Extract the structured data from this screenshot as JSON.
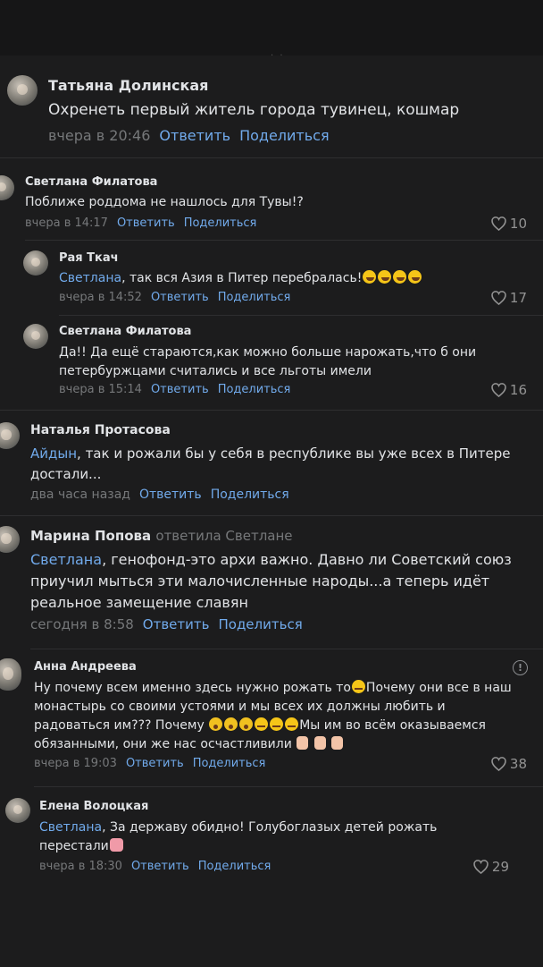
{
  "topbar": {
    "mark": ". ."
  },
  "actions": {
    "reply": "Ответить",
    "share": "Поделиться"
  },
  "comments": [
    {
      "name": "Татьяна Долинская",
      "text": "Охренеть первый житель города тувинец, кошмар",
      "time": "вчера в 20:46"
    },
    {
      "name": "Светлана Филатова",
      "text": "Поближе роддома не нашлось для Тувы!?",
      "time": "вчера в 14:17",
      "likes": "10"
    },
    {
      "name": "Рая Ткач",
      "mention": "Светлана",
      "text": ", так вся Азия в Питер перебралась!",
      "emoji": [
        "rolling-laugh",
        "rolling-laugh",
        "rolling-laugh",
        "rolling-laugh"
      ],
      "time": "вчера в 14:52",
      "likes": "17"
    },
    {
      "name": "Светлана Филатова",
      "text_lines": [
        "Да!! Да ещё стараются,как можно больше нарожать,что б они",
        "петербуржцами считались и все льготы имели"
      ],
      "time": "вчера в 15:14",
      "likes": "16"
    },
    {
      "name": "Наталья Протасова",
      "mention": "Айдын",
      "text_lines": [
        ", так и рожали бы у себя в республике вы уже всех в Питере",
        "достали..."
      ],
      "time": "два часа назад"
    },
    {
      "name": "Марина Попова",
      "reply_to": "ответила Светлане",
      "mention": "Светлана",
      "text_lines": [
        ", генофонд-это архи важно. Давно ли Советский союз",
        "приучил мыться эти малочисленные народы...а теперь идёт",
        "реальное замещение славян"
      ],
      "time": "сегодня в 8:58"
    },
    {
      "name": "Анна Андреева",
      "text_lines": [
        "Ну почему всем именно здесь нужно рожать то",
        "Почему они все в наш",
        "монастырь со своими устоями и мы всех их должны любить и",
        "радоваться им??? Почему ",
        "Мы им во всём оказываемся",
        "обязанными, они же нас осчастливили "
      ],
      "emoji": [
        "sad-face",
        "scream-face",
        "scream-face",
        "scream-face",
        "sad-face",
        "sad-face",
        "sad-face",
        "hand",
        "hand",
        "hand"
      ],
      "time": "вчера в 19:03",
      "likes": "38"
    },
    {
      "name": "Елена Волоцкая",
      "mention": "Светлана",
      "text_lines": [
        ", За державу обидно! Голубоглазых детей рожать",
        "перестали"
      ],
      "emoji": [
        "girl-gesture"
      ],
      "time": "вчера в 18:30",
      "likes": "29"
    }
  ]
}
